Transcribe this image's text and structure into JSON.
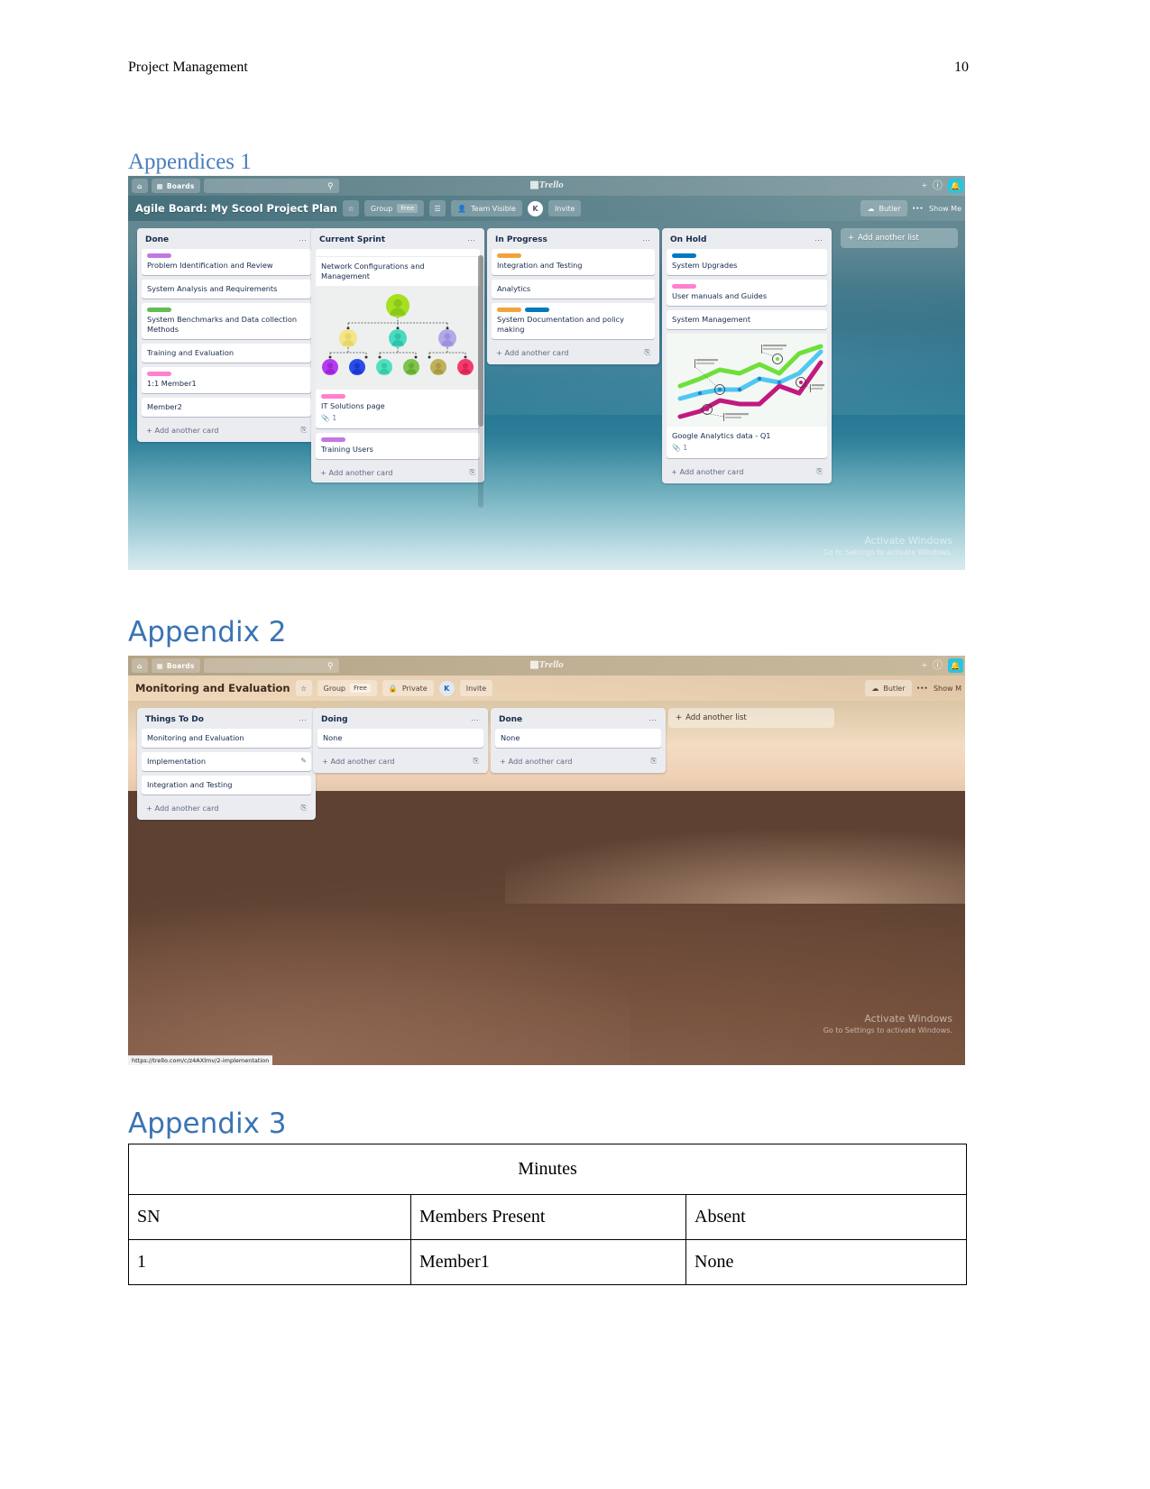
{
  "document": {
    "header_title": "Project Management",
    "page_number": "10"
  },
  "headings": {
    "appendices1": "Appendices 1",
    "appendix2": "Appendix 2",
    "appendix3": "Appendix 3"
  },
  "board1": {
    "topbar": {
      "home_icon": "home-icon",
      "boards_label": "Boards",
      "search_icon": "search-icon",
      "search_placeholder": "",
      "logo": "Trello",
      "add_icon": "plus-icon",
      "info_icon": "info-icon",
      "bell_icon": "bell-icon"
    },
    "board_bar": {
      "title": "Agile Board: My Scool Project Plan",
      "star_icon": "star-icon",
      "group_label": "Group",
      "plan_label": "Free",
      "list_icon": "list-view-icon",
      "visibility_label": "Team Visible",
      "avatar_initial": "K",
      "invite_label": "Invite",
      "butler_label": "Butler",
      "more_dots": "•••",
      "show_menu_label": "Show Me"
    },
    "add_another_list": "Add another list",
    "watermark": {
      "line1": "Activate Windows",
      "line2": "Go to Settings to activate Windows."
    },
    "lists": [
      {
        "title": "Done",
        "add_card": "Add another card",
        "cards": [
          {
            "labels": [
              "#c377e0"
            ],
            "text": "Problem Identification and Review"
          },
          {
            "labels": [],
            "text": "System Analysis and Requirements"
          },
          {
            "labels": [
              "#61bd4f"
            ],
            "text": "System Benchmarks and Data collection Methods"
          },
          {
            "labels": [],
            "text": "Training and Evaluation"
          },
          {
            "labels": [
              "#ff80ce"
            ],
            "text": "1:1 Member1"
          },
          {
            "labels": [],
            "text": "Member2"
          }
        ]
      },
      {
        "title": "Current Sprint",
        "add_card": "Add another card",
        "cards": [
          {
            "labels": [],
            "text": "Network Configurations and Management"
          },
          {
            "labels": [
              "#ff80ce"
            ],
            "text": "IT Solutions page",
            "attachments": "1",
            "image": "org-chart"
          },
          {
            "labels": [
              "#c377e0"
            ],
            "text": "Training Users"
          }
        ]
      },
      {
        "title": "In Progress",
        "add_card": "Add another card",
        "cards": [
          {
            "labels": [
              "#f2a33c"
            ],
            "text": "Integration and Testing"
          },
          {
            "labels": [],
            "text": "Analytics"
          },
          {
            "labels": [
              "#f2a33c",
              "#0079bf"
            ],
            "text": "System Documentation and policy making"
          }
        ]
      },
      {
        "title": "On Hold",
        "add_card": "Add another card",
        "cards": [
          {
            "labels": [
              "#0079bf"
            ],
            "text": "System Upgrades"
          },
          {
            "labels": [
              "#ff80ce"
            ],
            "text": "User manuals and Guides"
          },
          {
            "labels": [],
            "text": "System Management"
          },
          {
            "labels": [],
            "text": "Google Analytics data - Q1",
            "attachments": "1",
            "image": "line-chart"
          }
        ]
      }
    ]
  },
  "board2": {
    "topbar": {
      "boards_label": "Boards",
      "logo": "Trello"
    },
    "board_bar": {
      "title": "Monitoring and Evaluation",
      "star_icon": "star-icon",
      "group_label": "Group",
      "plan_label": "Free",
      "visibility_label": "Private",
      "avatar_initial": "K",
      "invite_label": "Invite",
      "butler_label": "Butler",
      "more_dots": "•••",
      "show_menu_label": "Show M"
    },
    "add_another_list": "Add another list",
    "status_url": "https://trello.com/c/z4AXlmv/2-implementation",
    "watermark": {
      "line1": "Activate Windows",
      "line2": "Go to Settings to activate Windows."
    },
    "lists": [
      {
        "title": "Things To Do",
        "add_card": "Add another card",
        "cards": [
          {
            "text": "Monitoring and Evaluation"
          },
          {
            "text": "Implementation",
            "edit": true
          },
          {
            "text": "Integration and Testing"
          }
        ]
      },
      {
        "title": "Doing",
        "add_card": "Add another card",
        "cards": [
          {
            "text": "None"
          }
        ]
      },
      {
        "title": "Done",
        "add_card": "Add another card",
        "cards": [
          {
            "text": "None"
          }
        ]
      }
    ]
  },
  "minutes_table": {
    "caption": "Minutes",
    "columns": [
      "SN",
      "Members Present",
      "Absent"
    ],
    "rows": [
      [
        "1",
        "Member1",
        "None"
      ]
    ]
  }
}
